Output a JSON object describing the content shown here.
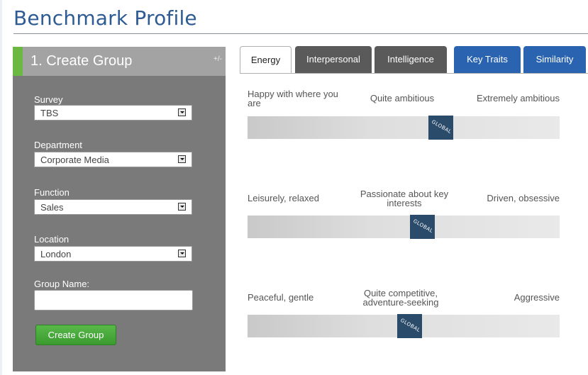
{
  "page": {
    "title": "Benchmark Profile"
  },
  "sidebar": {
    "title": "1. Create Group",
    "toggle": "+/-",
    "fields": {
      "survey": {
        "label": "Survey",
        "value": "TBS"
      },
      "department": {
        "label": "Department",
        "value": "Corporate Media"
      },
      "function": {
        "label": "Function",
        "value": "Sales"
      },
      "location": {
        "label": "Location",
        "value": "London"
      },
      "group_name": {
        "label": "Group Name:",
        "value": "",
        "placeholder": ""
      }
    },
    "button": "Create Group"
  },
  "tabs": [
    {
      "label": "Energy",
      "active": true
    },
    {
      "label": "Interpersonal"
    },
    {
      "label": "Intelligence"
    },
    {
      "label": "Key Traits"
    },
    {
      "label": "Similarity"
    }
  ],
  "scales": [
    {
      "left": "Happy with where you are",
      "middle": "Quite ambitious",
      "right": "Extremely ambitious",
      "marker": "GLOBAL",
      "position_fraction": 0.62
    },
    {
      "left": "Leisurely, relaxed",
      "middle": "Passionate about key interests",
      "right": "Driven, obsessive",
      "marker": "GLOBAL",
      "position_fraction": 0.56
    },
    {
      "left": "Peaceful, gentle",
      "middle": "Quite competitive, adventure-seeking",
      "right": "Aggressive",
      "marker": "GLOBAL",
      "position_fraction": 0.52
    }
  ],
  "colors": {
    "title": "#2e5b93",
    "accent_green": "#6bb843",
    "tab_blue": "#2a64b0",
    "marker": "#2b4b6b"
  }
}
